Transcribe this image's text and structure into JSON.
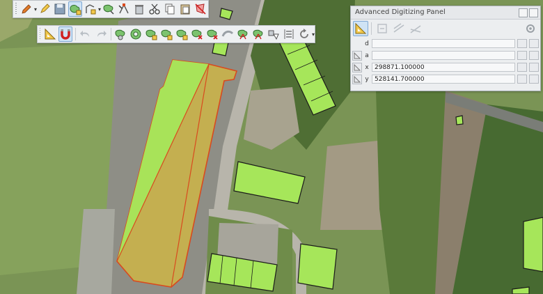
{
  "panel": {
    "title": "Advanced Digitizing Panel",
    "rows": [
      {
        "label": "d",
        "value": ""
      },
      {
        "label": "a",
        "value": ""
      },
      {
        "label": "x",
        "value": "298871.100000"
      },
      {
        "label": "y",
        "value": "528141.700000"
      }
    ]
  },
  "icons": {
    "toolbar_top": [
      "pencil-edit-icon",
      "toggle-editing-icon",
      "save-edits-icon",
      "add-polygon-icon",
      "add-feature-dropdown-icon",
      "move-feature-icon",
      "node-tool-icon",
      "delete-icon",
      "cut-icon",
      "copy-icon",
      "paste-icon",
      "undo-polygon-icon"
    ],
    "toolbar_second": [
      "advanced-digitizing-icon",
      "snapping-magnet-icon",
      "undo-icon",
      "redo-icon",
      "simplify-icon",
      "add-ring-icon",
      "add-part-icon",
      "fill-ring-icon",
      "delete-ring-icon",
      "delete-part-icon",
      "reshape-icon",
      "offset-curve-icon",
      "split-features-icon",
      "split-parts-icon",
      "merge-icon",
      "merge-attributes-icon",
      "rotate-icon"
    ]
  },
  "colors": {
    "building_fill": "#a6e65a",
    "selected_fill": "#c9b24c",
    "selected_edge": "#d94a1e",
    "toolbar_bg": "#eef0f2",
    "active_tool": "#cfe3f5"
  }
}
